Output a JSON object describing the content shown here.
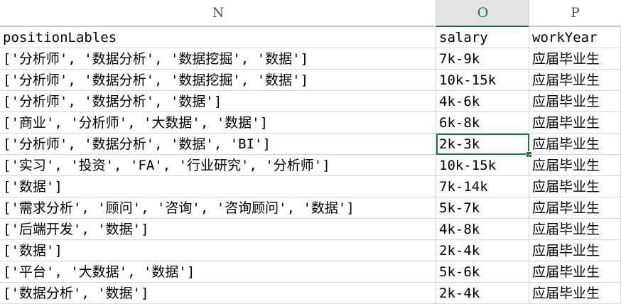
{
  "columns": [
    {
      "letter": "N",
      "selected": false
    },
    {
      "letter": "O",
      "selected": true
    },
    {
      "letter": "P",
      "selected": false
    }
  ],
  "rows": [
    {
      "n": "positionLables",
      "o": "salary",
      "p": "workYear"
    },
    {
      "n": "['分析师', '数据分析', '数据挖掘', '数据']",
      "o": "7k-9k",
      "p": "应届毕业生"
    },
    {
      "n": "['分析师', '数据分析', '数据挖掘', '数据']",
      "o": "10k-15k",
      "p": "应届毕业生"
    },
    {
      "n": "['分析师', '数据分析', '数据']",
      "o": "4k-6k",
      "p": "应届毕业生"
    },
    {
      "n": "['商业', '分析师', '大数据', '数据']",
      "o": "6k-8k",
      "p": "应届毕业生"
    },
    {
      "n": "['分析师', '数据分析', '数据', 'BI']",
      "o": "2k-3k",
      "p": "应届毕业生"
    },
    {
      "n": "['实习', '投资', 'FA', '行业研究', '分析师']",
      "o": "10k-15k",
      "p": "应届毕业生"
    },
    {
      "n": "['数据']",
      "o": "7k-14k",
      "p": "应届毕业生"
    },
    {
      "n": "['需求分析', '顾问', '咨询', '咨询顾问', '数据']",
      "o": "5k-7k",
      "p": "应届毕业生"
    },
    {
      "n": "['后端开发', '数据']",
      "o": "4k-8k",
      "p": "应届毕业生"
    },
    {
      "n": "['数据']",
      "o": "2k-4k",
      "p": "应届毕业生"
    },
    {
      "n": "['平台', '大数据', '数据']",
      "o": "5k-6k",
      "p": "应届毕业生"
    },
    {
      "n": "['数据分析', '数据']",
      "o": "2k-4k",
      "p": "应届毕业生"
    }
  ],
  "active_cell": {
    "row": 5,
    "col": "o"
  },
  "colors": {
    "accent": "#217346",
    "header_selected_bg": "#e3e3e3",
    "grid": "#d4d4d4"
  }
}
